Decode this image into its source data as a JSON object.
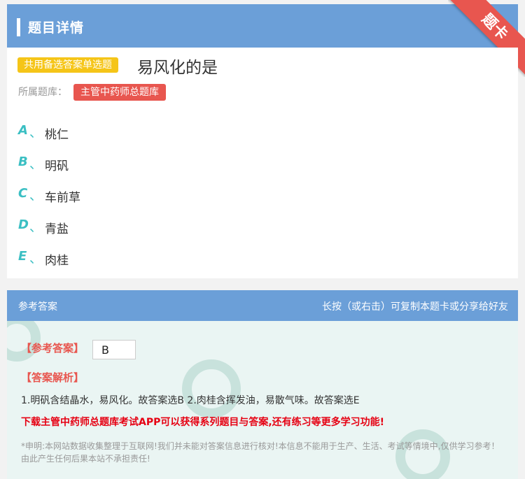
{
  "header": {
    "title": "题目详情",
    "ribbon": "题卡"
  },
  "question": {
    "type_badge": "共用备选答案单选题",
    "text": "易风化的是",
    "bank_label": "所属题库：",
    "bank_name": "主管中药师总题库",
    "options": [
      {
        "letter": "A",
        "sep": "、",
        "text": "桃仁"
      },
      {
        "letter": "B",
        "sep": "、",
        "text": "明矾"
      },
      {
        "letter": "C",
        "sep": "、",
        "text": "车前草"
      },
      {
        "letter": "D",
        "sep": "、",
        "text": "青盐"
      },
      {
        "letter": "E",
        "sep": "、",
        "text": "肉桂"
      }
    ]
  },
  "answer_section": {
    "title": "参考答案",
    "hint": "长按（或右击）可复制本题卡或分享给好友",
    "answer_label": "【参考答案】",
    "answer_value": "B",
    "analysis_label": "【答案解析】",
    "analysis_text": "1.明矾含结晶水，易风化。故答案选B 2.肉桂含挥发油，易散气味。故答案选E",
    "promo": "下载主管中药师总题库考试APP可以获得系列题目与答案,还有练习等更多学习功能!",
    "disclaimer": "*申明:本网站数据收集整理于互联网!我们并未能对答案信息进行核对!本信息不能用于生产、生活、考试等情境中,仅供学习参考！由此产生任何后果本站不承担责任!"
  },
  "colors": {
    "header_blue": "#6b9fd8",
    "accent_red": "#e8564f",
    "badge_yellow": "#f5c518",
    "option_teal": "#3bbfc3",
    "promo_red": "#e60012"
  }
}
